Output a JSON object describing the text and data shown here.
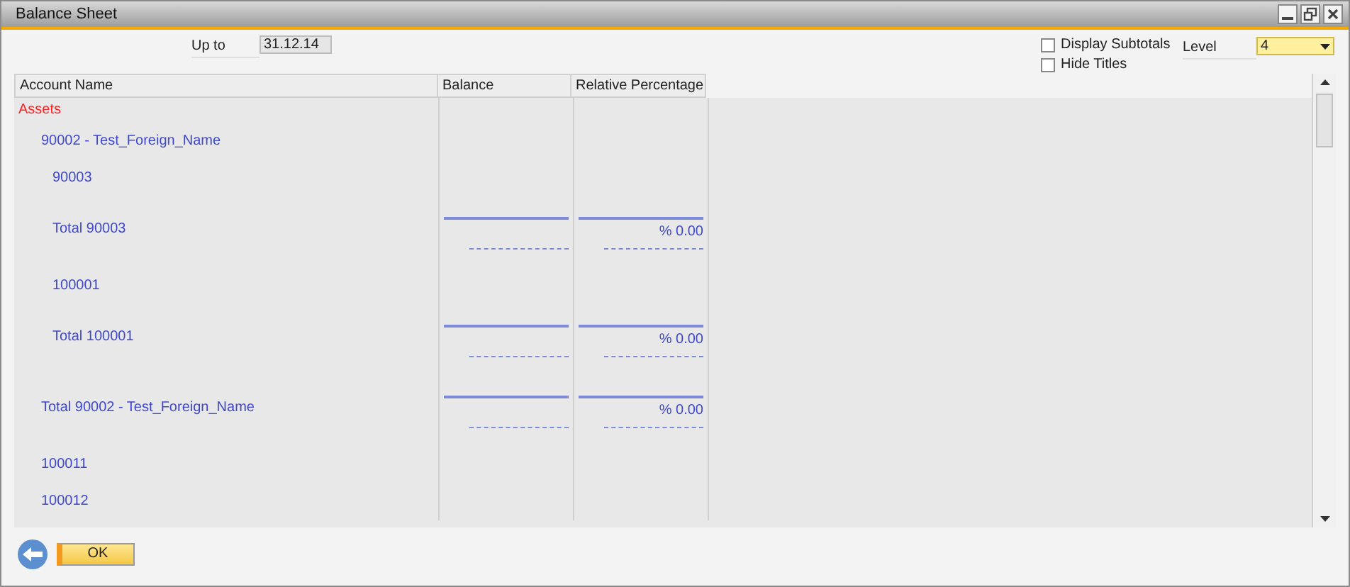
{
  "window": {
    "title": "Balance Sheet"
  },
  "filters": {
    "up_to_label": "Up to",
    "up_to_value": "31.12.14",
    "level_label": "Level",
    "level_value": "4"
  },
  "options": [
    {
      "label": "Display Subtotals",
      "checked": false
    },
    {
      "label": "Hide Titles",
      "checked": false
    }
  ],
  "table": {
    "columns": [
      "Account Name",
      "Balance",
      "Relative Percentage"
    ],
    "rows": [
      {
        "kind": "heading",
        "name": "Assets",
        "children": [
          {
            "kind": "account",
            "name": "90002 - Test_Foreign_Name",
            "children": [
              {
                "kind": "account",
                "name": "90003"
              },
              {
                "kind": "total",
                "name": "Total 90003",
                "percentage": "% 0.00"
              },
              {
                "kind": "account",
                "name": "100001"
              },
              {
                "kind": "total",
                "name": "Total 100001",
                "percentage": "% 0.00"
              }
            ]
          },
          {
            "kind": "total",
            "name": "Total 90002 - Test_Foreign_Name",
            "percentage": "% 0.00"
          },
          {
            "kind": "account",
            "name": "100011"
          },
          {
            "kind": "account",
            "name": "100012"
          }
        ]
      }
    ]
  },
  "buttons": [
    "OK"
  ]
}
